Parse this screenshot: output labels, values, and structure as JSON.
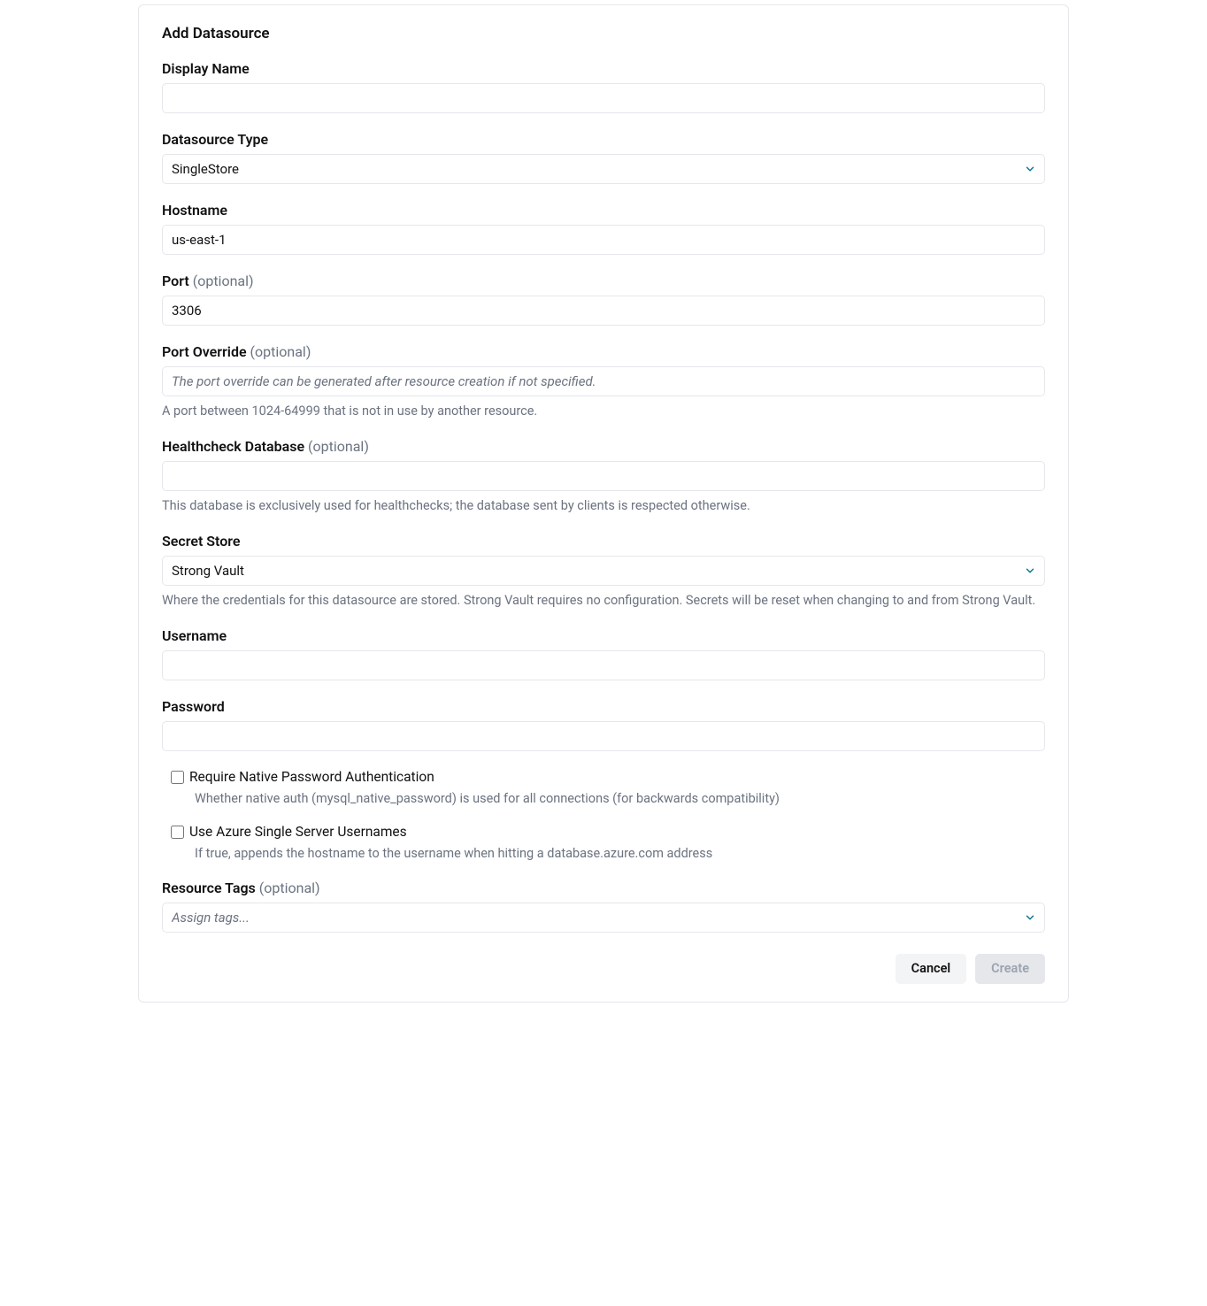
{
  "title": "Add Datasource",
  "fields": {
    "displayName": {
      "label": "Display Name",
      "value": ""
    },
    "datasourceType": {
      "label": "Datasource Type",
      "value": "SingleStore"
    },
    "hostname": {
      "label": "Hostname",
      "value": "us-east-1"
    },
    "port": {
      "label": "Port",
      "optional": "(optional)",
      "value": "3306"
    },
    "portOverride": {
      "label": "Port Override",
      "optional": "(optional)",
      "value": "",
      "placeholder": "The port override can be generated after resource creation if not specified.",
      "help": "A port between 1024-64999 that is not in use by another resource."
    },
    "healthcheckDatabase": {
      "label": "Healthcheck Database",
      "optional": "(optional)",
      "value": "",
      "help": "This database is exclusively used for healthchecks; the database sent by clients is respected otherwise."
    },
    "secretStore": {
      "label": "Secret Store",
      "value": "Strong Vault",
      "help": "Where the credentials for this datasource are stored. Strong Vault requires no configuration. Secrets will be reset when changing to and from Strong Vault."
    },
    "username": {
      "label": "Username",
      "value": ""
    },
    "password": {
      "label": "Password",
      "value": ""
    },
    "requireNativeAuth": {
      "label": "Require Native Password Authentication",
      "help": "Whether native auth (mysql_native_password) is used for all connections (for backwards compatibility)"
    },
    "useAzureUsernames": {
      "label": "Use Azure Single Server Usernames",
      "help": "If true, appends the hostname to the username when hitting a database.azure.com address"
    },
    "resourceTags": {
      "label": "Resource Tags",
      "optional": "(optional)",
      "value": "",
      "placeholder": "Assign tags..."
    }
  },
  "buttons": {
    "cancel": "Cancel",
    "create": "Create"
  }
}
